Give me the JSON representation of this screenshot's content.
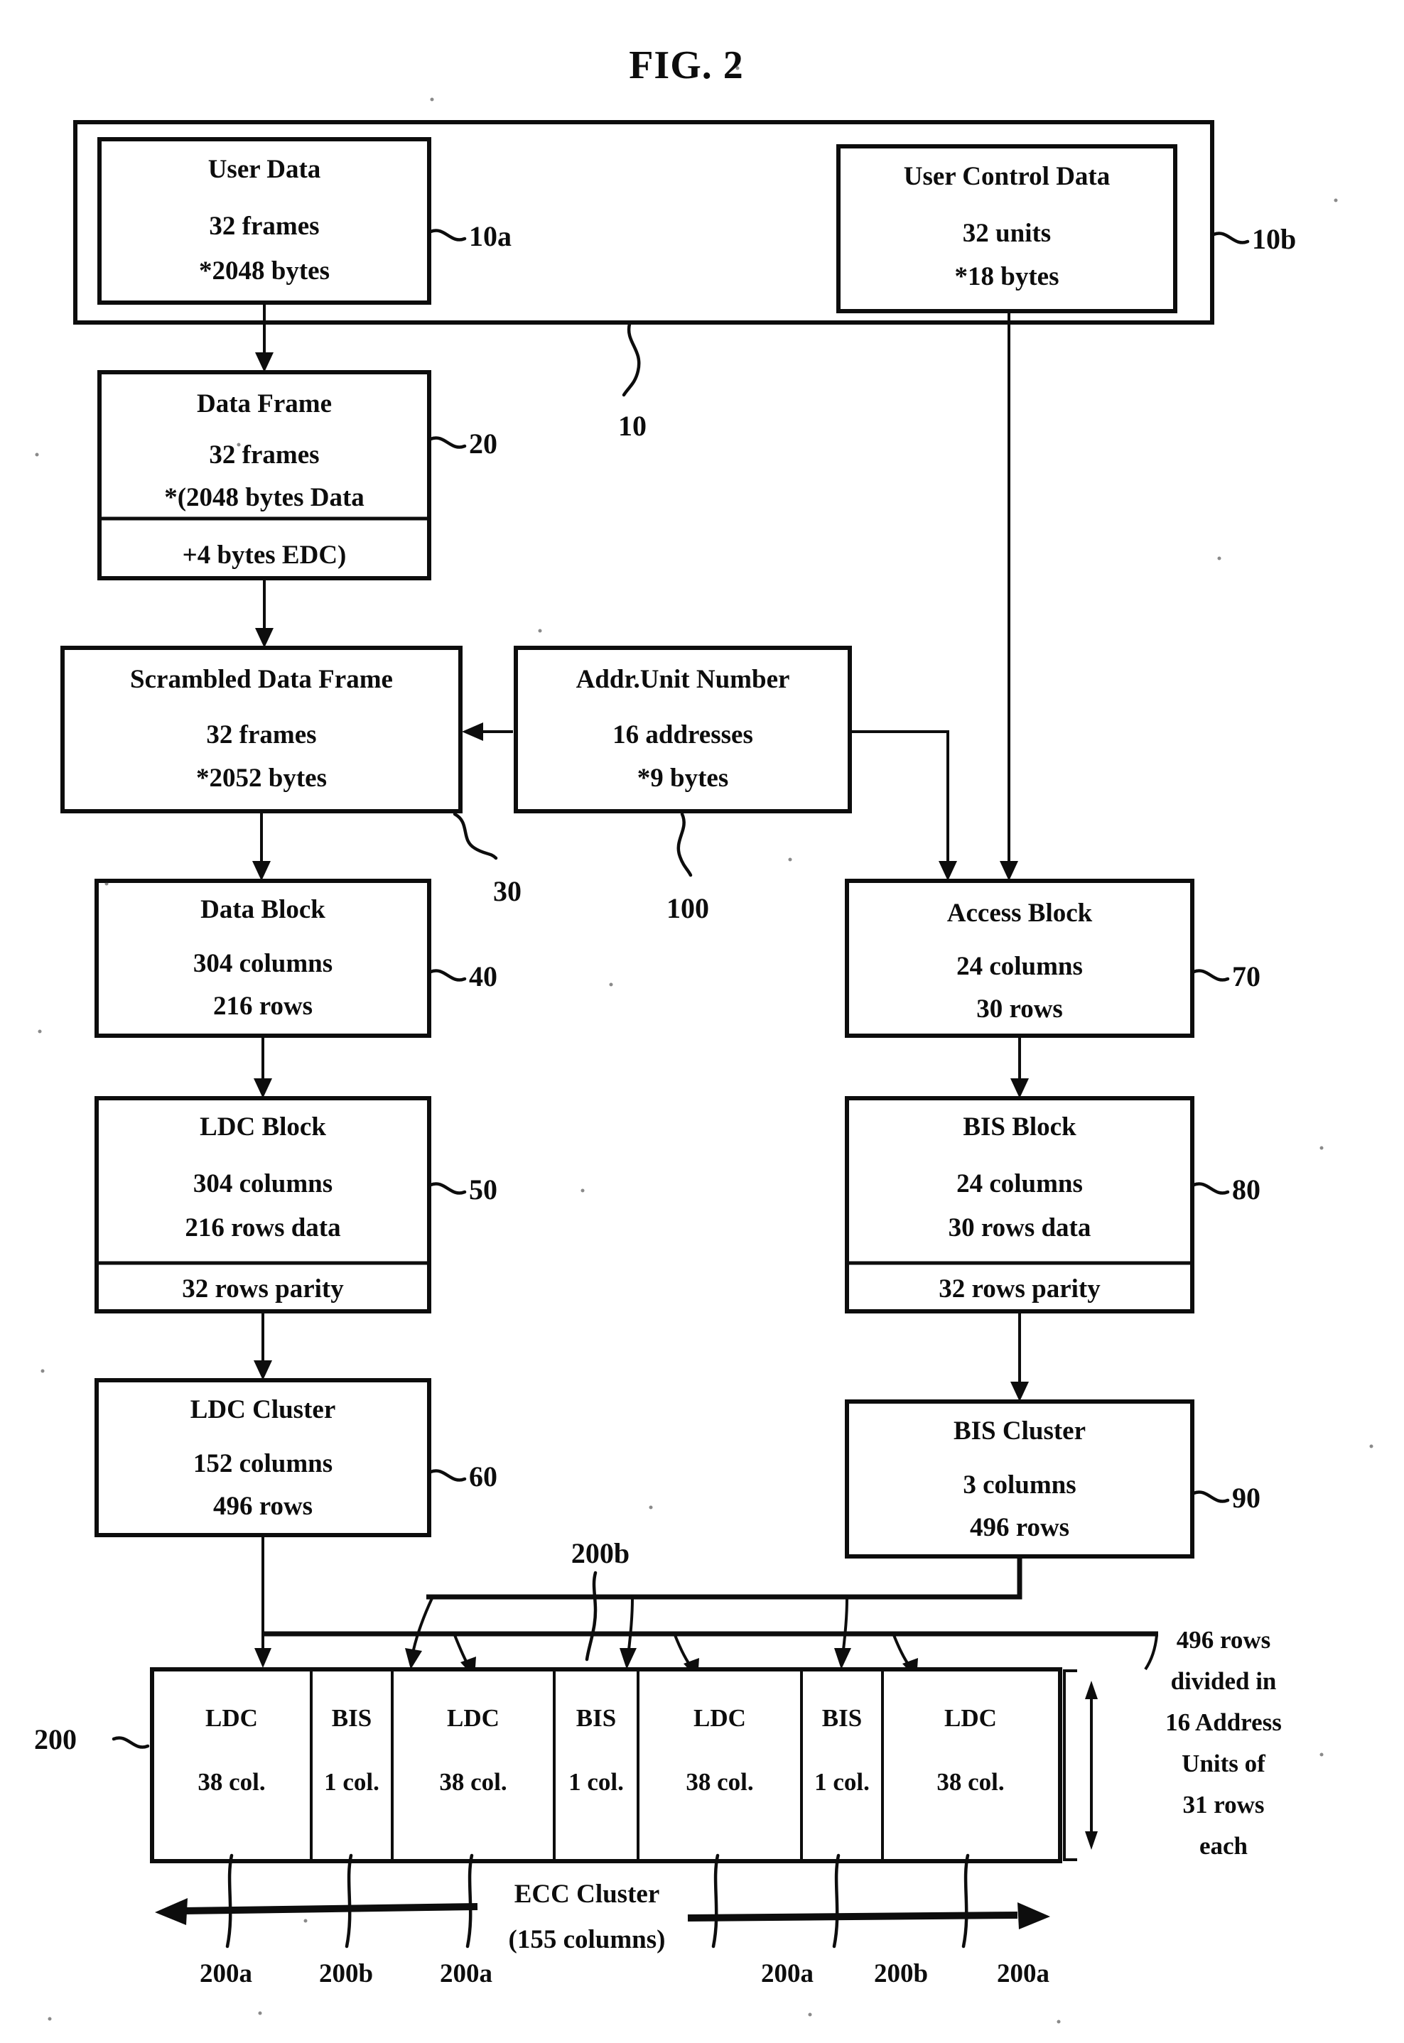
{
  "figure": {
    "title": "FIG. 2"
  },
  "group_10": {
    "ref": "10",
    "user_data": {
      "ref": "10a",
      "title": "User Data",
      "line1": "32 frames",
      "line2": "*2048 bytes"
    },
    "user_control_data": {
      "ref": "10b",
      "title": "User Control Data",
      "line1": "32 units",
      "line2": "*18 bytes"
    }
  },
  "data_frame": {
    "ref": "20",
    "title": "Data Frame",
    "line1": "32 frames",
    "line2": "*(2048 bytes Data",
    "footer": "+4 bytes EDC)"
  },
  "scrambled_data_frame": {
    "ref": "30",
    "title": "Scrambled Data Frame",
    "line1": "32 frames",
    "line2": "*2052 bytes"
  },
  "addr_unit_number": {
    "ref": "100",
    "title": "Addr.Unit Number",
    "line1": "16 addresses",
    "line2": "*9 bytes"
  },
  "data_block": {
    "ref": "40",
    "title": "Data Block",
    "line1": "304 columns",
    "line2": "216 rows"
  },
  "access_block": {
    "ref": "70",
    "title": "Access Block",
    "line1": "24 columns",
    "line2": "30 rows"
  },
  "ldc_block": {
    "ref": "50",
    "title": "LDC Block",
    "line1": "304 columns",
    "line2": "216 rows data",
    "footer": "32 rows parity"
  },
  "bis_block": {
    "ref": "80",
    "title": "BIS Block",
    "line1": "24 columns",
    "line2": "30 rows data",
    "footer": "32 rows parity"
  },
  "ldc_cluster": {
    "ref": "60",
    "title": "LDC Cluster",
    "line1": "152 columns",
    "line2": "496 rows"
  },
  "bis_cluster": {
    "ref": "90",
    "title": "BIS Cluster",
    "line1": "3 columns",
    "line2": "496 rows"
  },
  "ecc_cluster": {
    "ref": "200",
    "bus_ref": "200b",
    "caption_line1": "ECC Cluster",
    "caption_line2": "(155 columns)",
    "cells": [
      {
        "name": "LDC",
        "cols": "38 col."
      },
      {
        "name": "BIS",
        "cols": "1 col."
      },
      {
        "name": "LDC",
        "cols": "38 col."
      },
      {
        "name": "BIS",
        "cols": "1 col."
      },
      {
        "name": "LDC",
        "cols": "38 col."
      },
      {
        "name": "BIS",
        "cols": "1 col."
      },
      {
        "name": "LDC",
        "cols": "38 col."
      }
    ],
    "bottom_refs_left": [
      "200a",
      "200b",
      "200a"
    ],
    "bottom_refs_right": [
      "200a",
      "200b",
      "200a"
    ],
    "side_note": [
      "496 rows",
      "divided in",
      "16 Address",
      "Units of",
      "31 rows",
      "each"
    ]
  }
}
